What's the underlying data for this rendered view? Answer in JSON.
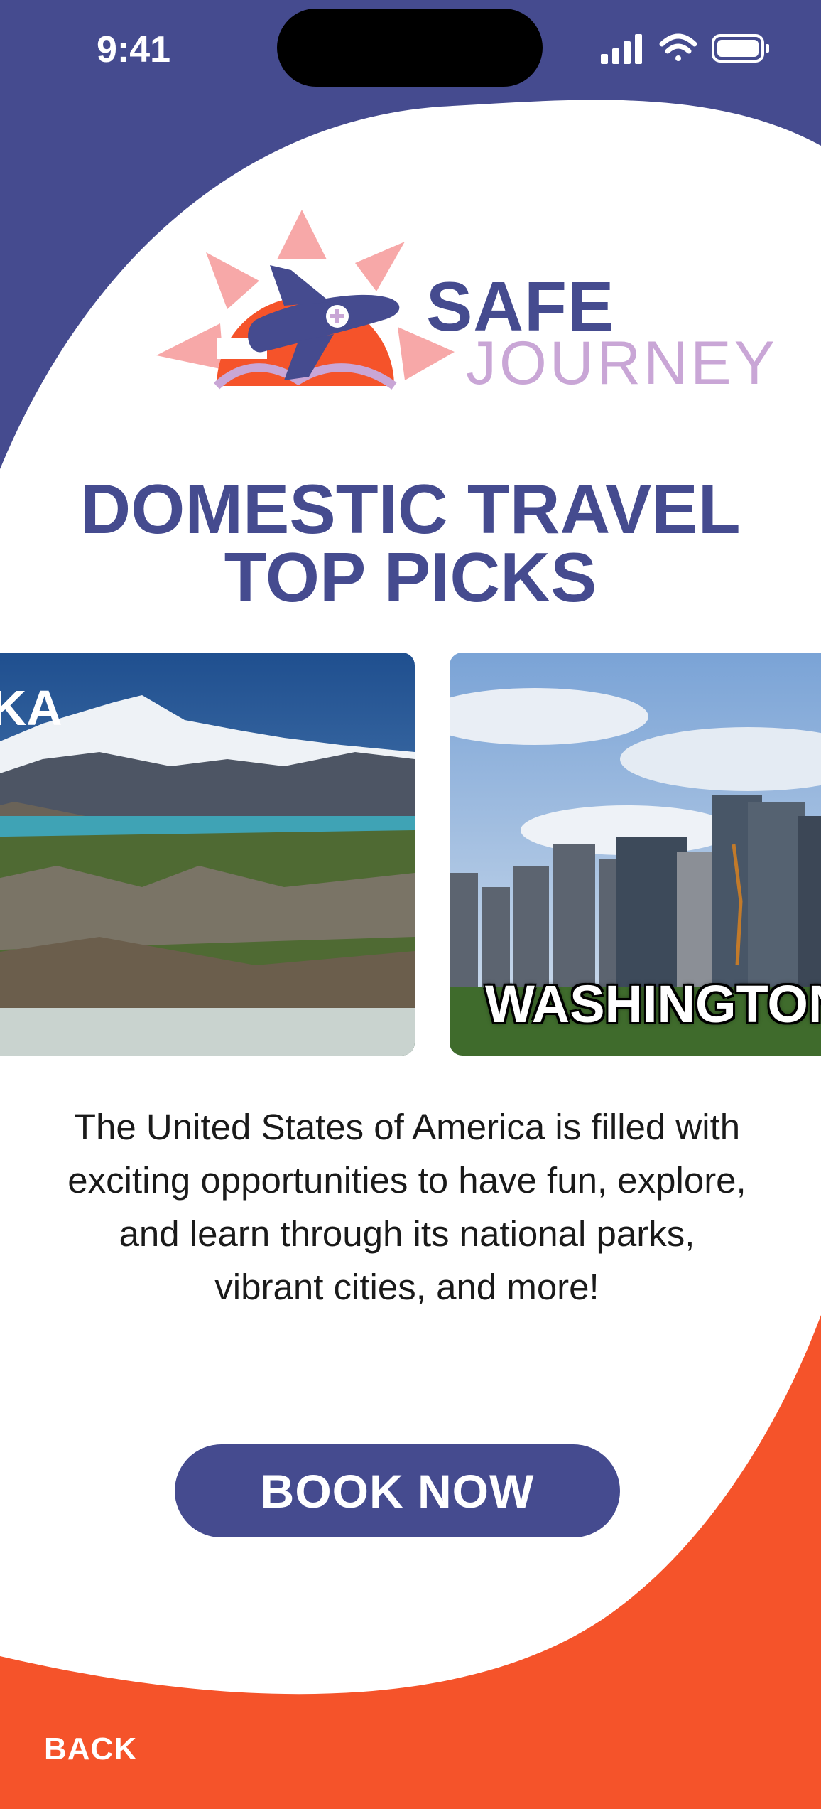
{
  "status_bar": {
    "time": "9:41",
    "icons": [
      "signal-icon",
      "wifi-icon",
      "battery-icon"
    ]
  },
  "brand": {
    "line1": "SAFE",
    "line2": "JOURNEY",
    "logo_icon": "airplane-sun-logo"
  },
  "headline": {
    "line1": "DOMESTIC TRAVEL",
    "line2": "TOP PICKS"
  },
  "carousel": {
    "cards": [
      {
        "label": "SKA",
        "scene": "alaska-mountains-image"
      },
      {
        "label": "WASHINGTON",
        "scene": "washington-skyline-image"
      }
    ]
  },
  "description": "The United States of America is filled with exciting opportunities to have fun, explore, and learn through its national parks, vibrant cities, and more!",
  "actions": {
    "book_now": "BOOK NOW",
    "back": "BACK"
  },
  "colors": {
    "navy": "#454b8f",
    "orange": "#f5532a",
    "lavender": "#c9a6d6",
    "pink": "#f7a8a8"
  }
}
